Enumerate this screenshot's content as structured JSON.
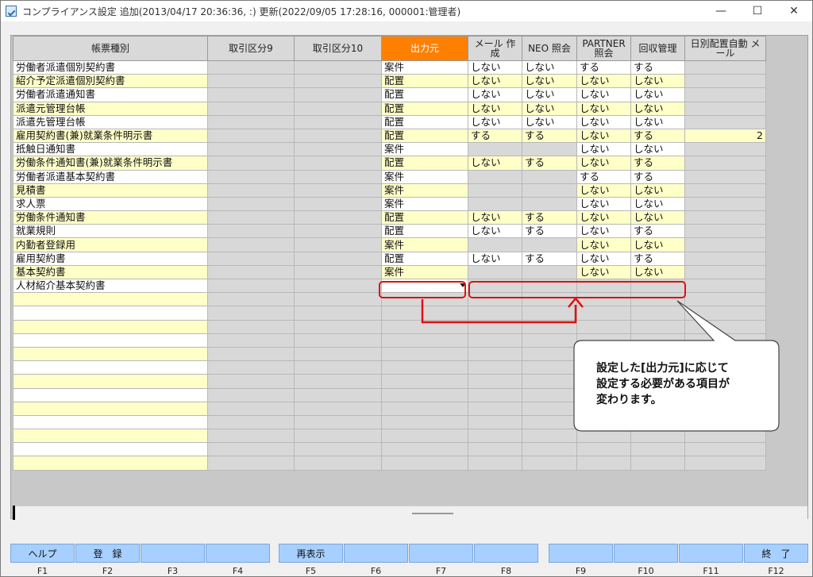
{
  "window": {
    "title": "コンプライアンス設定  追加(2013/04/17 20:36:36, :) 更新(2022/09/05 17:28:16, 000001:管理者)",
    "min_glyph": "—",
    "max_glyph": "☐",
    "close_glyph": "✕"
  },
  "table": {
    "headers": [
      "帳票種別",
      "取引区分9",
      "取引区分10",
      "出力元",
      "メール 作成",
      "NEO 照会",
      "PARTNER 照会",
      "回収管理",
      "日別配置自動 メール"
    ],
    "rows": [
      {
        "name": "労働者派遣個別契約書",
        "c3": "案件",
        "c4": "しない",
        "c5": "しない",
        "c6": "する",
        "c7": "する",
        "c8": ""
      },
      {
        "name": "紹介予定派遣個別契約書",
        "c3": "配置",
        "c4": "しない",
        "c5": "しない",
        "c6": "しない",
        "c7": "しない",
        "c8": ""
      },
      {
        "name": "労働者派遣通知書",
        "c3": "配置",
        "c4": "しない",
        "c5": "しない",
        "c6": "しない",
        "c7": "しない",
        "c8": ""
      },
      {
        "name": "派遣元管理台帳",
        "c3": "配置",
        "c4": "しない",
        "c5": "しない",
        "c6": "しない",
        "c7": "しない",
        "c8": ""
      },
      {
        "name": "派遣先管理台帳",
        "c3": "配置",
        "c4": "しない",
        "c5": "しない",
        "c6": "しない",
        "c7": "しない",
        "c8": ""
      },
      {
        "name": "雇用契約書(兼)就業条件明示書",
        "c3": "配置",
        "c4": "する",
        "c5": "する",
        "c6": "しない",
        "c7": "する",
        "c8": "2"
      },
      {
        "name": "抵触日通知書",
        "c3": "案件",
        "c4": "",
        "c5": "",
        "c6": "しない",
        "c7": "しない",
        "c8": ""
      },
      {
        "name": "労働条件通知書(兼)就業条件明示書",
        "c3": "配置",
        "c4": "しない",
        "c5": "する",
        "c6": "しない",
        "c7": "する",
        "c8": ""
      },
      {
        "name": "労働者派遣基本契約書",
        "c3": "案件",
        "c4": "",
        "c5": "",
        "c6": "する",
        "c7": "する",
        "c8": ""
      },
      {
        "name": "見積書",
        "c3": "案件",
        "c4": "",
        "c5": "",
        "c6": "しない",
        "c7": "しない",
        "c8": ""
      },
      {
        "name": "求人票",
        "c3": "案件",
        "c4": "",
        "c5": "",
        "c6": "しない",
        "c7": "しない",
        "c8": ""
      },
      {
        "name": "労働条件通知書",
        "c3": "配置",
        "c4": "しない",
        "c5": "する",
        "c6": "しない",
        "c7": "しない",
        "c8": ""
      },
      {
        "name": "就業規則",
        "c3": "配置",
        "c4": "しない",
        "c5": "する",
        "c6": "しない",
        "c7": "する",
        "c8": ""
      },
      {
        "name": "内勤者登録用",
        "c3": "案件",
        "c4": "",
        "c5": "",
        "c6": "しない",
        "c7": "しない",
        "c8": ""
      },
      {
        "name": "雇用契約書",
        "c3": "配置",
        "c4": "しない",
        "c5": "する",
        "c6": "しない",
        "c7": "する",
        "c8": ""
      },
      {
        "name": "基本契約書",
        "c3": "案件",
        "c4": "",
        "c5": "",
        "c6": "しない",
        "c7": "しない",
        "c8": ""
      },
      {
        "name": "人材紹介基本契約書",
        "c3": "",
        "c4": "",
        "c5": "",
        "c6": "",
        "c7": "",
        "c8": ""
      }
    ],
    "empty_rows": 13
  },
  "callout": {
    "line1": "設定した[出力元]に応じて",
    "line2": "設定する必要がある項目が",
    "line3": "変わります。"
  },
  "fkeys": [
    {
      "label": "ヘルプ",
      "key": "F1"
    },
    {
      "label": "登　録",
      "key": "F2"
    },
    {
      "label": "",
      "key": "F3"
    },
    {
      "label": "",
      "key": "F4"
    },
    {
      "label": "再表示",
      "key": "F5"
    },
    {
      "label": "",
      "key": "F6"
    },
    {
      "label": "",
      "key": "F7"
    },
    {
      "label": "",
      "key": "F8"
    },
    {
      "label": "",
      "key": "F9"
    },
    {
      "label": "",
      "key": "F10"
    },
    {
      "label": "",
      "key": "F11"
    },
    {
      "label": "終　了",
      "key": "F12"
    }
  ],
  "colors": {
    "header_orange": "#ff8000",
    "row_yellow": "#ffffc8",
    "fkey_blue": "#a7cfff",
    "annotation_red": "#e01010"
  }
}
